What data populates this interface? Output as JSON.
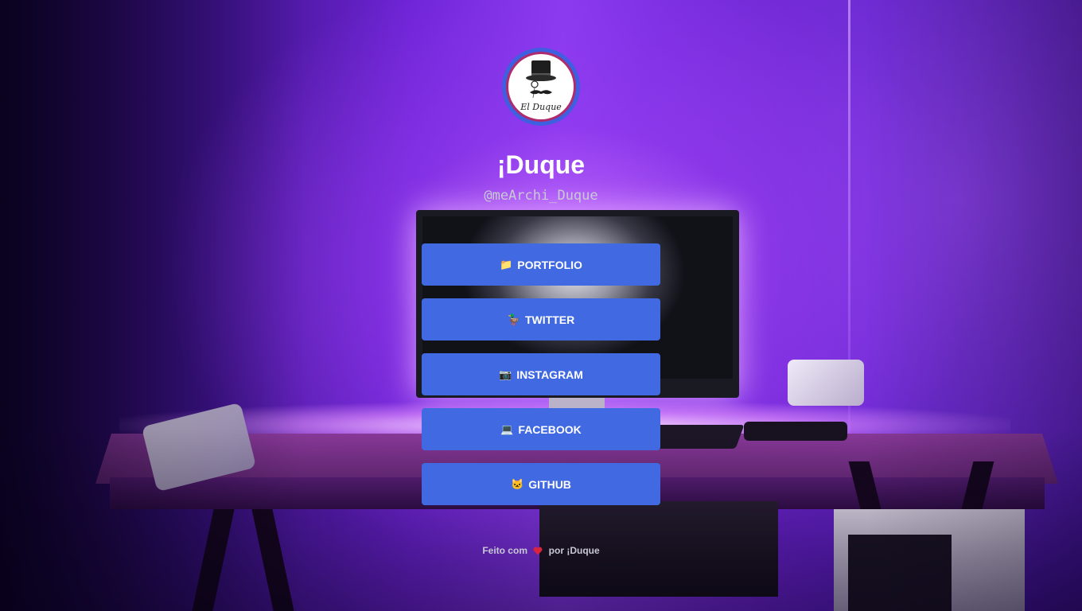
{
  "profile": {
    "avatar_text": "El Duque",
    "name": "¡Duque",
    "handle": "@meArchi_Duque"
  },
  "links": [
    {
      "emoji": "📁",
      "label": "PORTFOLIO",
      "icon": "folder-icon"
    },
    {
      "emoji": "🦆",
      "label": "TWITTER",
      "icon": "bird-icon"
    },
    {
      "emoji": "📷",
      "label": "INSTAGRAM",
      "icon": "camera-icon"
    },
    {
      "emoji": "💻",
      "label": "FACEBOOK",
      "icon": "laptop-icon"
    },
    {
      "emoji": "🐱",
      "label": "GITHUB",
      "icon": "cat-icon"
    }
  ],
  "footer": {
    "prefix": "Feito com",
    "suffix": "por ¡Duque",
    "heart_icon": "heart-icon"
  },
  "colors": {
    "button_bg": "#4169e1",
    "avatar_ring": "#3d5fe0",
    "text_primary": "#ffffff",
    "text_muted": "#c9c9d6",
    "heart": "#d8243c"
  }
}
